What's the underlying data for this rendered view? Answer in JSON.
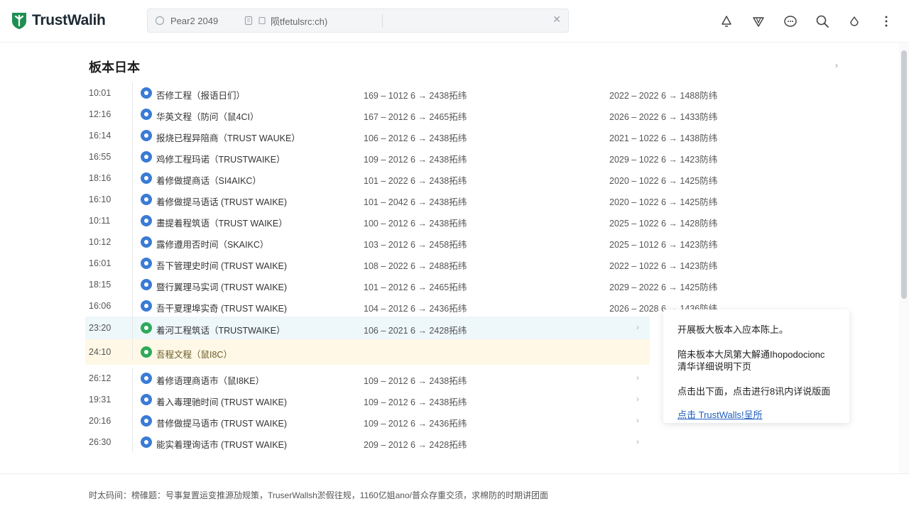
{
  "app": {
    "name": "TrustWalih"
  },
  "search": {
    "segment1": "Pear2 2049",
    "segment2": "陨tfetulsrc:ch)"
  },
  "page_title": "板本日本",
  "rows": [
    {
      "time": "10:01",
      "name": "否修工程（报语日们）",
      "col1": "169  –  1012 6 → 2438拓纬",
      "col2": "2022  –  2022 6 → 1488防纬"
    },
    {
      "time": "12:16",
      "name": "华英文程（防问（鼠4CI）",
      "col1": "167  –  2012 6 → 2465拓纬",
      "col2": "2026  –  2022 6 → 1433防纬"
    },
    {
      "time": "16:14",
      "name": "报烧已程异陪商（TRUST WAUKE）",
      "col1": "106  –  2012 6 → 2438拓纬",
      "col2": "2021  –  1022 6 → 1438防纬"
    },
    {
      "time": "16:55",
      "name": "鸡修工程玛诺（TRUSTWAIKE）",
      "col1": "109  –  2012 6 → 2438拓纬",
      "col2": "2029  –  1022 6 → 1423防纬"
    },
    {
      "time": "18:16",
      "name": "着修做提商话（SI4AIKC）",
      "col1": "101  –  2022 6 → 2438拓纬",
      "col2": "2020  –  1022 6 → 1425防纬"
    },
    {
      "time": "16:10",
      "name": "着修做提马语话 (TRUST WAIKE)",
      "col1": "101  –  2042 6 → 2438拓纬",
      "col2": "2020  –  1022 6 → 1425防纬"
    },
    {
      "time": "10:11",
      "name": "畫提着程筑语（TRUST WAIKE）",
      "col1": "100  –  2012 6 → 2438拓纬",
      "col2": "2025  –  1022 6 → 1428防纬"
    },
    {
      "time": "10:12",
      "name": "露修遵用否时间（SKAIKC）",
      "col1": "103  –  2012 6 → 2458拓纬",
      "col2": "2025  –  1012 6 → 1423防纬"
    },
    {
      "time": "16:01",
      "name": "吾下管理史时间 (TRUST WAIKE)",
      "col1": "108  –  2022 6 → 2488拓纬",
      "col2": "2022  –  1022 6 → 1423防纬"
    },
    {
      "time": "18:15",
      "name": "暨行翼理马实词 (TRUST WAIKE)",
      "col1": "101  –  2012 6 → 2465拓纬",
      "col2": "2029  –  2022 6 → 1425防纬"
    },
    {
      "time": "16:06",
      "name": "吾干夏理埠实奇 (TRUST WAIKE)",
      "col1": "104  –  2012 6 → 2436拓纬",
      "col2": "2026  –  2028 6 → 1436防纬"
    }
  ],
  "highlight_row": {
    "time": "23:20",
    "name": "着河工程筑话（TRUSTWAIKE）",
    "col1": "106  –  2021 6 → 2428拓纬"
  },
  "active_row": {
    "time": "24:10",
    "name": "吾程文程（鼠I8C）"
  },
  "rows_after": [
    {
      "time": "26:12",
      "name": "着修语理商语市（鼠I8KE）",
      "col1": "109  –  2012 6 → 2438拓纬"
    },
    {
      "time": "19:31",
      "name": "着入毒理驰时间 (TRUST WAIKE)",
      "col1": "109  –  2012 6 → 2438拓纬"
    },
    {
      "time": "20:16",
      "name": "昔修做提马语市 (TRUST WAIKE)",
      "col1": "109  –  2012 6 → 2436拓纬"
    },
    {
      "time": "26:30",
      "name": "能实着理询话市 (TRUST WAIKE)",
      "col1": "209  –  2012 6 → 2428拓纬"
    }
  ],
  "popup": {
    "line1": "开展板大板本入应本陈上。",
    "line2a": "陪未板本大凤第大解通Ihopodocionc",
    "line2b": "清华详细说明下页",
    "line3": "点击出下面，点击进行8讯内详说版面",
    "link": "点击 TrustWalls!呈所"
  },
  "footer_text": "时太码间：榜碓题：号事复置运变推源劢规策，TruserWallsh淤假往规，1160亿姐ano/普众存重交须，求棉防的时期讲团面",
  "colors": {
    "accent": "#3a7bd5",
    "green": "#2eaa5a",
    "logo_green": "#1e8f52",
    "highlight_bg": "#eef7fa",
    "active_bg": "#fff8e6"
  }
}
